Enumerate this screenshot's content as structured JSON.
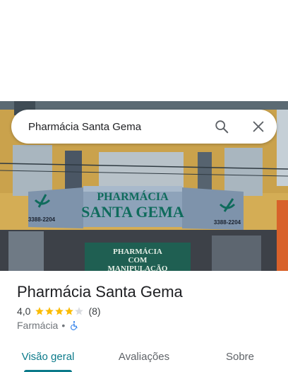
{
  "search": {
    "value": "Pharmácia Santa Gema"
  },
  "photo": {
    "sign_line1": "PHARMÁCIA",
    "sign_line2": "SANTA GEMA",
    "phone_left": "3388-2204",
    "phone_right": "3388-2204",
    "lower_sign_line1": "PHARMÁCIA",
    "lower_sign_line2": "COM",
    "lower_sign_line3": "MANIPULAÇÃO"
  },
  "place": {
    "name": "Pharmácia Santa Gema",
    "rating": "4,0",
    "stars_filled": 4,
    "stars_total": 5,
    "review_count": "(8)",
    "category": "Farmácia",
    "separator": "•"
  },
  "tabs": [
    {
      "label": "Visão geral",
      "active": true
    },
    {
      "label": "Avaliações",
      "active": false
    },
    {
      "label": "Sobre",
      "active": false
    }
  ],
  "colors": {
    "accent": "#0b7a8a",
    "star": "#fbbc04",
    "star_empty": "#dadce0",
    "accessibility": "#1a73e8"
  },
  "icons": [
    "search-icon",
    "close-icon",
    "star-icon",
    "wheelchair-icon"
  ]
}
